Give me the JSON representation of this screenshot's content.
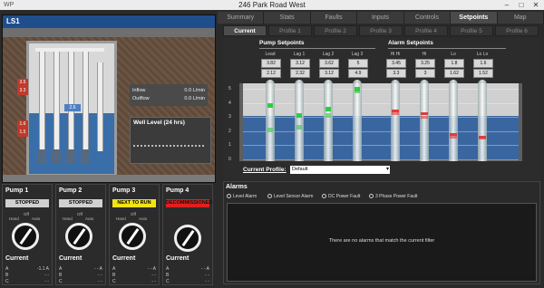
{
  "window": {
    "title": "246 Park Road West",
    "app_mark": "WP",
    "min": "–",
    "max": "□",
    "close": "✕"
  },
  "site": {
    "id": "LS1",
    "level_badge": "2.6",
    "markers_left": [
      "3.5",
      "3.3",
      "1.6",
      "1.5"
    ],
    "flow": [
      {
        "label": "Inflow",
        "value": "0.0 L/min"
      },
      {
        "label": "Outflow",
        "value": "0.0 L/min"
      }
    ],
    "trend_label": "Well Level (24 hrs)"
  },
  "pumps": [
    {
      "name": "Pump 1",
      "status": "STOPPED",
      "status_color": "#d0d0d0",
      "off": "Off",
      "hand": "Hand",
      "auto": "Auto",
      "current_label": "Current",
      "phases": [
        {
          "p": "A",
          "v": "-1.1 A"
        },
        {
          "p": "B",
          "v": "- -"
        },
        {
          "p": "C",
          "v": "- -"
        }
      ]
    },
    {
      "name": "Pump 2",
      "status": "STOPPED",
      "status_color": "#d0d0d0",
      "off": "Off",
      "hand": "Hand",
      "auto": "Auto",
      "current_label": "Current",
      "phases": [
        {
          "p": "A",
          "v": "- - A"
        },
        {
          "p": "B",
          "v": "- -"
        },
        {
          "p": "C",
          "v": "- -"
        }
      ]
    },
    {
      "name": "Pump 3",
      "status": "NEXT TO RUN",
      "status_color": "#f2e316",
      "off": "Off",
      "hand": "Hand",
      "auto": "Auto",
      "current_label": "Current",
      "phases": [
        {
          "p": "A",
          "v": "- - A"
        },
        {
          "p": "B",
          "v": "- -"
        },
        {
          "p": "C",
          "v": "- -"
        }
      ]
    },
    {
      "name": "Pump 4",
      "status": "DECOMMISSIONED",
      "status_color": "#e02020",
      "off": "",
      "hand": "",
      "auto": "",
      "current_label": "Current",
      "phases": [
        {
          "p": "A",
          "v": "- - A"
        },
        {
          "p": "B",
          "v": "- -"
        },
        {
          "p": "C",
          "v": "- -"
        }
      ]
    }
  ],
  "tabs": [
    "Summary",
    "Stats",
    "Faults",
    "Inputs",
    "Controls",
    "Setpoints",
    "Map"
  ],
  "active_tab": "Setpoints",
  "subtabs": [
    "Current",
    "Profile 1",
    "Profile 2",
    "Profile 3",
    "Profile 4",
    "Profile 5",
    "Profile 6"
  ],
  "active_subtab": "Current",
  "setpoints": {
    "pump_header": "Pump Setpoints",
    "alarm_header": "Alarm Setpoints",
    "columns": [
      {
        "name": "Lead",
        "on": "3.82",
        "off": "2.12"
      },
      {
        "name": "Lag 1",
        "on": "3.12",
        "off": "2.32"
      },
      {
        "name": "Lag 2",
        "on": "3.62",
        "off": "3.12"
      },
      {
        "name": "Lag 3",
        "on": "5",
        "off": "4.9"
      },
      {
        "name": "Hi Hi",
        "on": "3.45",
        "off": "3.3"
      },
      {
        "name": "Hi",
        "on": "3.25",
        "off": "3"
      },
      {
        "name": "Lo",
        "on": "1.8",
        "off": "1.62"
      },
      {
        "name": "Lo Lo",
        "on": "1.6",
        "off": "1.52"
      }
    ],
    "y_ticks": [
      "5",
      "4",
      "3",
      "2",
      "1",
      "0"
    ],
    "current_profile_label": "Current Profile:",
    "current_profile_value": "Default",
    "dropdown_glyph": "▾"
  },
  "alarms": {
    "header": "Alarms",
    "filters": [
      "Level Alarm",
      "Level Sensor Alarm",
      "DC Power Fault",
      "3 Phase Power Fault"
    ],
    "empty_message": "There are no alarms that match the current filter"
  }
}
